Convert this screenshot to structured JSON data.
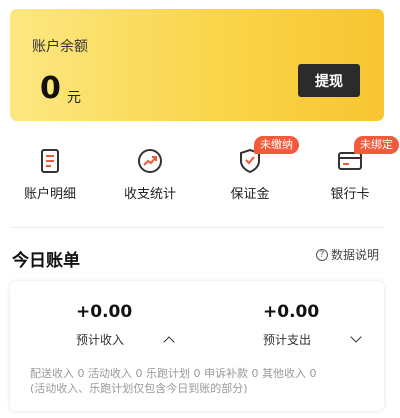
{
  "balance": {
    "title": "账户余额",
    "amount": "0",
    "unit": "元",
    "withdraw_label": "提现"
  },
  "shortcuts": [
    {
      "label": "账户明细",
      "icon": "document-icon"
    },
    {
      "label": "收支统计",
      "icon": "chart-trend-icon"
    },
    {
      "label": "保证金",
      "icon": "shield-icon",
      "badge": "未缴纳"
    },
    {
      "label": "银行卡",
      "icon": "bank-card-icon",
      "badge": "未绑定"
    }
  ],
  "today_bill": {
    "title": "今日账单",
    "help_label": "数据说明",
    "income": {
      "value": "+0.00",
      "label": "预计收入"
    },
    "expense": {
      "value": "+0.00",
      "label": "预计支出"
    },
    "detail_line1": "配送收入 0 活动收入 0 乐跑计划 0 申诉补款 0 其他收入 0",
    "detail_line2": "(活动收入、乐跑计划仅包含今日到账的部分)"
  },
  "colors": {
    "accent_red": "#f15a3a",
    "card_yellow": "#fad54a",
    "button_dark": "#2b2b2b"
  }
}
